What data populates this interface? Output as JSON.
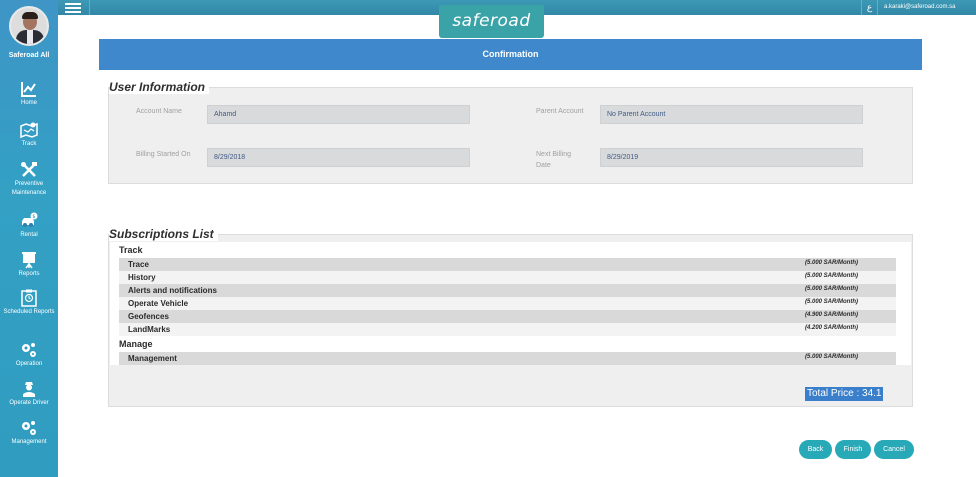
{
  "app": {
    "logo_text": "saferoad",
    "logo_mark": "s"
  },
  "topbar": {
    "language_label": "ع",
    "user_email": "a.karaki@saferoad.com.sa"
  },
  "sidebar": {
    "profile_name": "Saferoad All",
    "items": [
      {
        "label": "Home",
        "icon": "chart-icon"
      },
      {
        "label": "Track",
        "icon": "map-icon"
      },
      {
        "label": "Preventive Maintenance",
        "icon": "tools-icon"
      },
      {
        "label": "Rental",
        "icon": "car-icon"
      },
      {
        "label": "Reports",
        "icon": "presentation-icon"
      },
      {
        "label": "Scheduled Reports",
        "icon": "clipboard-icon"
      },
      {
        "label": "Operation",
        "icon": "gears-icon"
      },
      {
        "label": "Operate Driver",
        "icon": "driver-icon"
      },
      {
        "label": "Management",
        "icon": "gears-icon"
      }
    ]
  },
  "header": {
    "title": "Confirmation"
  },
  "user_info": {
    "legend": "User Information",
    "account_name_label": "Account Name",
    "account_name_value": "Ahamd",
    "parent_account_label": "Parent Account",
    "parent_account_value": "No Parent Account",
    "billing_started_label": "Billing Started On",
    "billing_started_value": "8/29/2018",
    "next_billing_label": "Next Billing Date",
    "next_billing_value": "8/29/2019"
  },
  "subscriptions": {
    "legend": "Subscriptions List",
    "groups": [
      {
        "title": "Track",
        "items": [
          {
            "name": "Trace",
            "price": "(5.000 SAR/Month)"
          },
          {
            "name": "History",
            "price": "(5.000 SAR/Month)"
          },
          {
            "name": "Alerts and notifications",
            "price": "(5.000 SAR/Month)"
          },
          {
            "name": "Operate Vehicle",
            "price": "(5.000 SAR/Month)"
          },
          {
            "name": "Geofences",
            "price": "(4.900 SAR/Month)"
          },
          {
            "name": "LandMarks",
            "price": "(4.200 SAR/Month)"
          }
        ]
      },
      {
        "title": "Manage",
        "items": [
          {
            "name": "Management",
            "price": "(5.000 SAR/Month)"
          }
        ]
      }
    ],
    "total_price": "Total Price : 34.1"
  },
  "actions": {
    "back": "Back",
    "finish": "Finish",
    "cancel": "Cancel"
  }
}
